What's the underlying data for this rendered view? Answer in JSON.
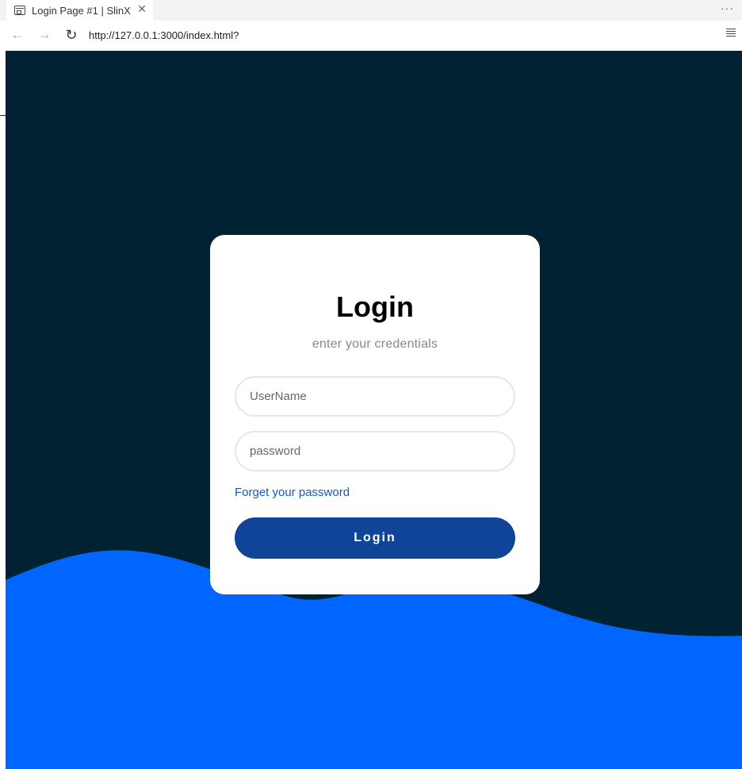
{
  "browser": {
    "tab_title": "Login Page #1 | SlinX",
    "tab_close_glyph": "✕",
    "more_glyph": "···",
    "back_glyph": "←",
    "forward_glyph": "→",
    "reload_glyph": "↻",
    "url": "http://127.0.0.1:3000/index.html?"
  },
  "colors": {
    "background_dark": "#012233",
    "wave_blue": "#0066ff",
    "button": "#0f4499",
    "link": "#1a56b8",
    "card": "#ffffff"
  },
  "login": {
    "title": "Login",
    "subtitle": "enter your credentials",
    "username_placeholder": "UserName",
    "password_placeholder": "password",
    "forgot_link": "Forget your password",
    "button_label": "Login"
  }
}
